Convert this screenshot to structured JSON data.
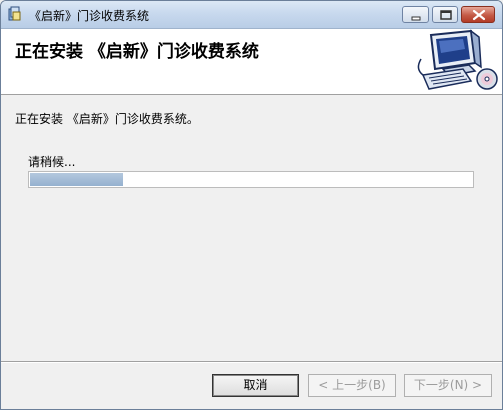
{
  "window": {
    "title": "《启新》门诊收费系统",
    "icon": "installer-icon"
  },
  "header": {
    "title": "正在安装 《启新》门诊收费系统",
    "art": "computer-cd-icon"
  },
  "main": {
    "status_text": "正在安装 《启新》门诊收费系统。",
    "wait_label": "请稍候...",
    "progress": 0.21
  },
  "buttons": {
    "cancel_label": "取消",
    "back_label": "< 上一步(B)",
    "next_label": "下一步(N) >"
  },
  "colors": {
    "progress_fill": "#9fb8d5",
    "titlebar": "#c8d9ee",
    "close_button": "#c45a46"
  }
}
